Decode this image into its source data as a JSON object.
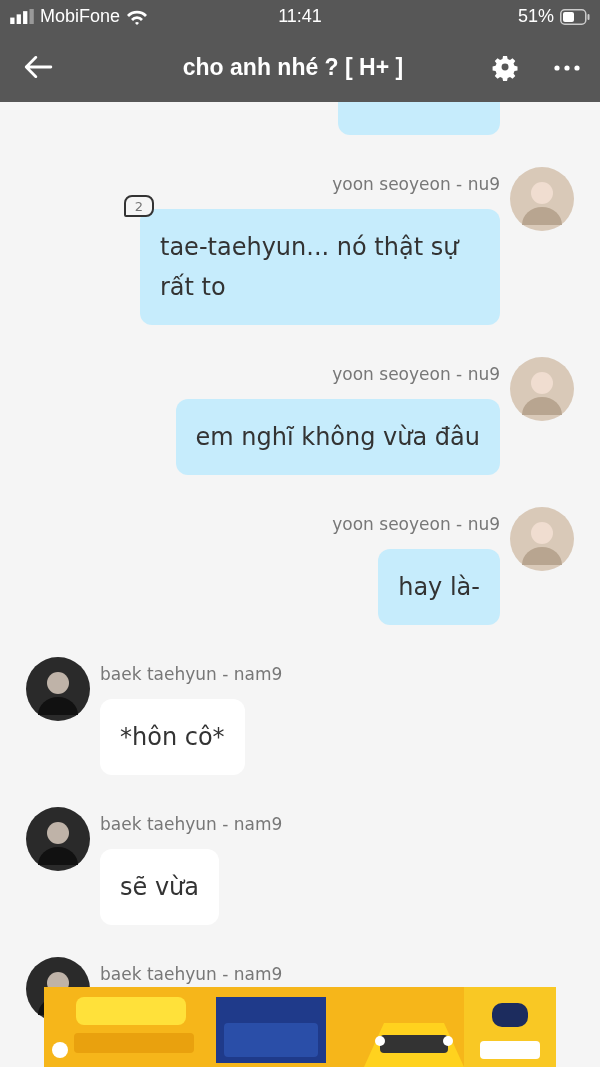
{
  "status_bar": {
    "carrier": "MobiFone",
    "time": "11:41",
    "battery": "51%"
  },
  "header": {
    "title": "cho anh nhé ? [ H+ ]"
  },
  "messages": [
    {
      "kind": "right",
      "name": "yoon seoyeon - nu9",
      "text": "tae-taehyun... nó thật sự rất to",
      "badge": "2"
    },
    {
      "kind": "right",
      "name": "yoon seoyeon - nu9",
      "text": "em nghĩ không vừa đâu"
    },
    {
      "kind": "right",
      "name": "yoon seoyeon - nu9",
      "text": "hay là-"
    },
    {
      "kind": "left",
      "name": "baek taehyun - nam9",
      "text": "*hôn cô*"
    },
    {
      "kind": "left",
      "name": "baek taehyun - nam9",
      "text": "sẽ vừa"
    },
    {
      "kind": "left",
      "name": "baek taehyun - nam9"
    }
  ]
}
